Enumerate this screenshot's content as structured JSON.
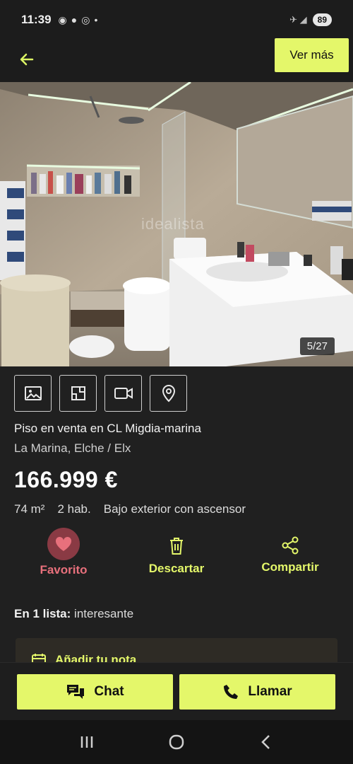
{
  "status_bar": {
    "time": "11:39",
    "battery": "89"
  },
  "app_bar": {
    "ver_mas_label": "Ver más"
  },
  "photo": {
    "counter": "5/27",
    "watermark": "idealista"
  },
  "listing": {
    "title": "Piso en venta en CL Migdia-marina",
    "location": "La Marina, Elche / Elx",
    "price": "166.999 €",
    "features": [
      "74 m²",
      "2 hab.",
      "Bajo exterior con ascensor"
    ]
  },
  "actions": {
    "favorito": "Favorito",
    "descartar": "Descartar",
    "compartir": "Compartir"
  },
  "list_info": {
    "prefix": "En 1 lista:",
    "value": " interesante"
  },
  "note": {
    "label": "Añadir tu nota"
  },
  "bottom": {
    "chat": "Chat",
    "llamar": "Llamar"
  },
  "colors": {
    "accent": "#e4f76a",
    "favorite": "#e8707c",
    "background": "#202020"
  },
  "icons": [
    "back-arrow-icon",
    "photos-icon",
    "floorplan-icon",
    "video-icon",
    "map-pin-icon",
    "heart-icon",
    "trash-icon",
    "share-icon",
    "note-icon",
    "chat-icon",
    "phone-icon"
  ]
}
